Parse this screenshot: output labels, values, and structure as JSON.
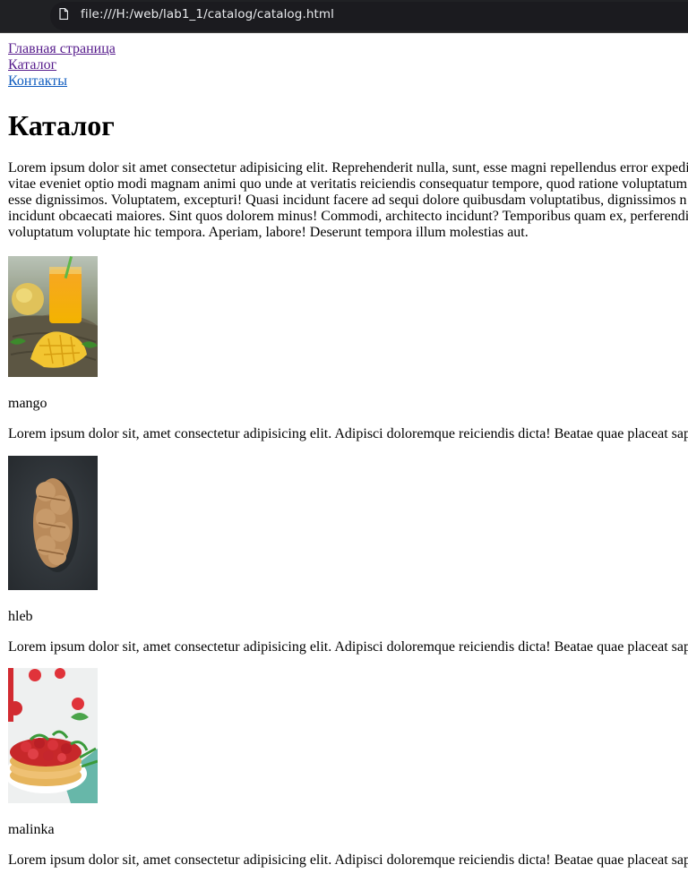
{
  "browser": {
    "url": "file:///H:/web/lab1_1/catalog/catalog.html"
  },
  "nav": {
    "items": [
      {
        "label": "Главная страница"
      },
      {
        "label": "Каталог"
      },
      {
        "label": "Контакты"
      }
    ]
  },
  "page": {
    "heading": "Каталог",
    "intro_lines": [
      "Lorem ipsum dolor sit amet consectetur adipisicing elit. Reprehenderit nulla, sunt, esse magni repellendus error expedi",
      "vitae eveniet optio modi magnam animi quo unde at veritatis reiciendis consequatur tempore, quod ratione voluptatum n",
      "esse dignissimos. Voluptatem, excepturi! Quasi incidunt facere ad sequi dolore quibusdam voluptatibus, dignissimos n",
      "incidunt obcaecati maiores. Sint quos dolorem minus! Commodi, architecto incidunt? Temporibus quam ex, perferendi",
      "voluptatum voluptate hic tempora. Aperiam, labore! Deserunt tempora illum molestias aut."
    ]
  },
  "catalog": {
    "items": [
      {
        "name": "mango",
        "description": "Lorem ipsum dolor sit, amet consectetur adipisicing elit. Adipisci doloremque reiciendis dicta! Beatae quae placeat sap",
        "image": "mango-photo"
      },
      {
        "name": "hleb",
        "description": "Lorem ipsum dolor sit, amet consectetur adipisicing elit. Adipisci doloremque reiciendis dicta! Beatae quae placeat sap",
        "image": "bread-photo"
      },
      {
        "name": "malinka",
        "description": "Lorem ipsum dolor sit, amet consectetur adipisicing elit. Adipisci doloremque reiciendis dicta! Beatae quae placeat sap",
        "image": "raspberry-pancakes-photo"
      }
    ]
  }
}
